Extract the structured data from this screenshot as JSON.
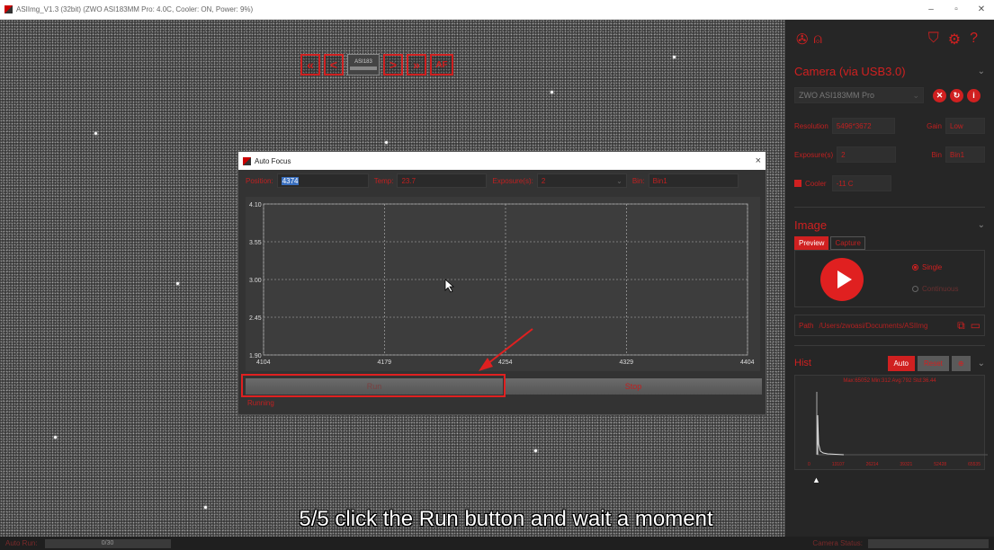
{
  "app": {
    "title": "ASIImg_V1.3 (32bit)  (ZWO ASI183MM Pro: 4.0C, Cooler: ON, Power: 9%)",
    "window_controls": [
      "–",
      "▫",
      "✕"
    ]
  },
  "toolbar": {
    "first_label": "«",
    "prev_label": "<",
    "thumb_label": "ASI183",
    "next_label": ">",
    "last_label": "»",
    "af_label": "AF"
  },
  "dialog": {
    "title": "Auto Focus",
    "close": "×",
    "position_label": "Position:",
    "position_value": "4374",
    "temp_label": "Temp:",
    "temp_value": "23.7",
    "exposure_label": "Exposure(s):",
    "exposure_value": "2",
    "bin_label": "Bin:",
    "bin_value": "Bin1",
    "run_label": "Run",
    "stop_label": "Stop",
    "status": "Running"
  },
  "chart_data": {
    "type": "line",
    "title": "",
    "xlabel": "",
    "ylabel": "",
    "x_ticks": [
      "4104",
      "4179",
      "4254",
      "4329",
      "4404"
    ],
    "y_ticks": [
      "1.90",
      "2.45",
      "3.00",
      "3.55",
      "4.10"
    ],
    "xlim": [
      4104,
      4404
    ],
    "ylim": [
      1.9,
      4.1
    ],
    "grid": true,
    "series": []
  },
  "sidebar": {
    "camera_section": "Camera (via USB3.0)",
    "camera_name": "ZWO ASI183MM Pro",
    "resolution_label": "Resolution",
    "resolution_value": "5496*3672",
    "gain_label": "Gain",
    "gain_value": "Low",
    "exposure_label": "Exposure(s)",
    "exposure_value": "2",
    "bin_label": "Bin",
    "bin_value": "Bin1",
    "cooler_label": "Cooler",
    "cooler_value": "-11 C",
    "image_section": "Image",
    "tab_preview": "Preview",
    "tab_capture": "Capture",
    "mode_single": "Single",
    "mode_continuous": "Continuous",
    "path_label": "Path",
    "path_value": "/Users/zwoasi/Documents/ASIImg",
    "hist_section": "Hist",
    "hist_auto": "Auto",
    "hist_reset": "Reset",
    "hist_stats": "Max:65052 Min:312 Avg:792 Std:36.44",
    "hist_ticks": [
      "0",
      "13107",
      "26214",
      "39321",
      "52428",
      "65535"
    ]
  },
  "status": {
    "auto_run_label": "Auto Run:",
    "progress_text": "0/30",
    "progress_fraction": 0,
    "camera_status_label": "Camera Status:"
  },
  "caption": "5/5 click the Run button and wait a moment",
  "colors": {
    "accent": "#d02020",
    "panel": "#262626",
    "plot_bg": "#3a3a3a"
  }
}
